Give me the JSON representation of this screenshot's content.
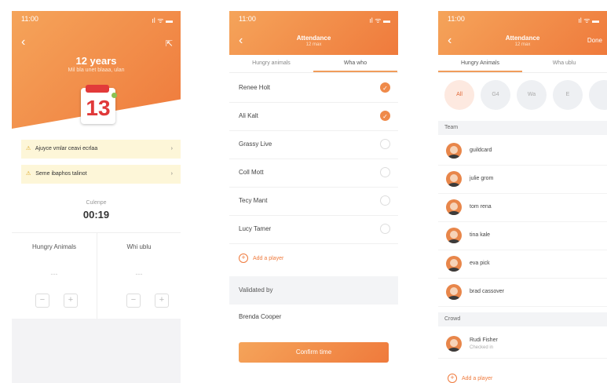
{
  "colors": {
    "accent": "#ef7a3c",
    "accent_light": "#f5a45a",
    "banner_bg": "#fdf6d8",
    "warn": "#d9a21b"
  },
  "screen1": {
    "status_time": "11:00",
    "status_right": "ıl ᯤ ▬",
    "age_title": "12 years",
    "age_subtitle": "Mil bla unet blaaa, ulan",
    "calendar_tag": "",
    "calendar_number": "13",
    "banners": [
      {
        "text": "Ajuyce vmlar ceavi ecrlaa"
      },
      {
        "text": "Seme ibaphos talinot"
      }
    ],
    "timer_label": "Culenpe",
    "timer_value": "00:19",
    "teams": [
      {
        "name": "Hungry Animals"
      },
      {
        "name": "Whi ublu"
      }
    ],
    "scores": [
      "---",
      "---"
    ],
    "minus": "−",
    "plus": "+"
  },
  "screen2": {
    "status_time": "11:00",
    "status_right": "ıl ᯤ ▬",
    "title": "Attendance",
    "subtitle": "12 max",
    "tabs": [
      "Hungry animals",
      "Wha who"
    ],
    "players": [
      {
        "name": "Renee Holt",
        "checked": true
      },
      {
        "name": "Ali Kalt",
        "checked": true
      },
      {
        "name": "Grassy Live",
        "checked": false
      },
      {
        "name": "Coll Mott",
        "checked": false
      },
      {
        "name": "Tecy Mant",
        "checked": false
      },
      {
        "name": "Lucy Tamer",
        "checked": false
      }
    ],
    "add_player": "Add a player",
    "validated_by": "Validated by",
    "validator_name": "Brenda Cooper",
    "confirm": "Confirm time"
  },
  "screen3": {
    "status_time": "11:00",
    "status_right": "ıl ᯤ ▬",
    "title": "Attendance",
    "subtitle": "12 max",
    "done": "Done",
    "tabs": [
      "Hungry Animals",
      "Wha ublu"
    ],
    "chips": [
      "All",
      "G4",
      "Wa",
      "E",
      ""
    ],
    "sections": [
      "Team",
      "Crowd"
    ],
    "team_members": [
      "guildcard",
      "julie grom",
      "tom rena",
      "tina kale",
      "eva pick",
      "brad cassover"
    ],
    "crowd_members": [
      {
        "name": "Rudi Fisher",
        "status": "Checked in"
      }
    ],
    "add_player": "Add a player"
  }
}
